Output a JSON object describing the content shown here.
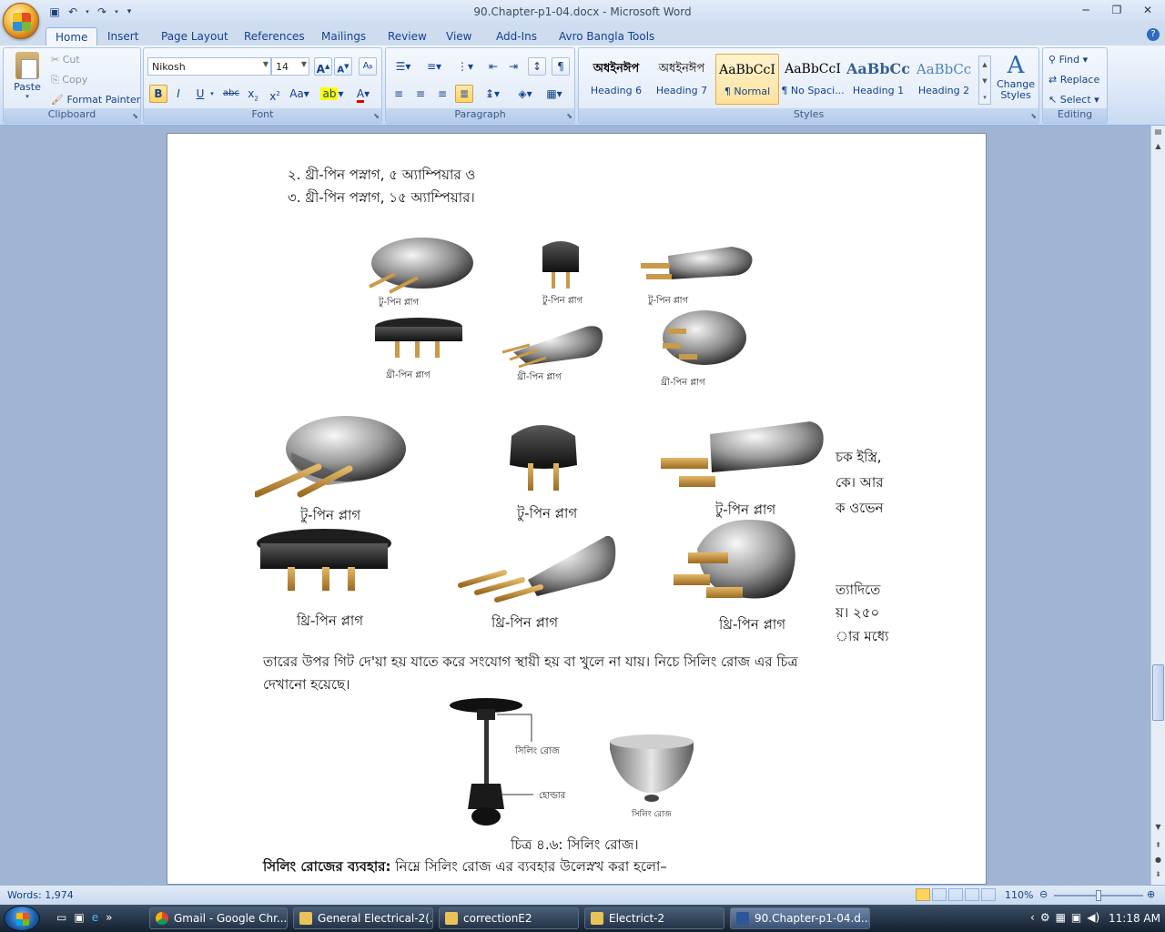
{
  "window": {
    "title": "90.Chapter-p1-04.docx - Microsoft Word"
  },
  "tabs": [
    "Home",
    "Insert",
    "Page Layout",
    "References",
    "Mailings",
    "Review",
    "View",
    "Add-Ins",
    "Avro Bangla Tools"
  ],
  "clipboard": {
    "paste": "Paste",
    "cut": "Cut",
    "copy": "Copy",
    "format_painter": "Format Painter",
    "label": "Clipboard"
  },
  "font": {
    "name": "Nikosh",
    "size": "14",
    "label": "Font"
  },
  "paragraph": {
    "label": "Paragraph"
  },
  "styles": {
    "label": "Styles",
    "items": [
      {
        "preview": "অধইনঈপ",
        "name": "Heading 6"
      },
      {
        "preview": "অধইনঈপ",
        "name": "Heading 7"
      },
      {
        "preview": "AaBbCcI",
        "name": "¶ Normal"
      },
      {
        "preview": "AaBbCcI",
        "name": "¶ No Spaci..."
      },
      {
        "preview": "AaBbCc",
        "name": "Heading 1"
      },
      {
        "preview": "AaBbCc",
        "name": "Heading 2"
      }
    ],
    "change_styles": "Change Styles"
  },
  "editing": {
    "find": "Find",
    "replace": "Replace",
    "select": "Select",
    "label": "Editing"
  },
  "document": {
    "line1": "২. থ্রী-পিন পস্নাগ, ৫ অ্যাম্পিয়ার ও",
    "line2": "৩. থ্রী-পিন পস্নাগ, ১৫ অ্যাম্পিয়ার।",
    "small_captions": [
      "টু-পিন প্লাগ",
      "টু-পিন প্লাগ",
      "টু-পিন প্লাগ",
      "থ্রী-পিন প্লাগ",
      "থ্রী-পিন প্লাগ",
      "থ্রী-পিন প্লাগ"
    ],
    "big_captions": [
      "টু-পিন প্লাগ",
      "টু-পিন প্লাগ",
      "টু-পিন প্লাগ",
      "থ্রি-পিন প্লাগ",
      "থ্রি-পিন প্লাগ",
      "থ্রি-পিন প্লাগ"
    ],
    "right_fragments": [
      "চক ইস্ত্রি,",
      "কে। আর",
      "ক ওভেন",
      "ত্যাদিতে",
      "য়। ২৫০",
      "ার মধ্যে"
    ],
    "para1": "তারের উপর গিট দে'য়া হয় যাতে করে সংযোগ স্থায়ী হয় বা খুলে না যায়। নিচে সিলিং রোজ এর চিত্র",
    "para2": "দেখানো হয়েছে।",
    "rose_label1": "সিলিং রোজ",
    "rose_label2": "হোল্ডার",
    "rose_label3": "সিলিং রোজ",
    "figure_caption": "চিত্র ৪.৬: সিলিং রোজ।",
    "heading_bold": "সিলিং রোজের ব্যবহার:",
    "heading_rest": " নিম্নে সিলিং রোজ এর ব্যবহার উলেস্নখ করা হলো–"
  },
  "status": {
    "words": "Words: 1,974",
    "zoom": "110%"
  },
  "taskbar": {
    "items": [
      "Gmail - Google Chr...",
      "General Electrical-2(...",
      "correctionE2",
      "Electrict-2",
      "90.Chapter-p1-04.d..."
    ],
    "time": "11:18 AM"
  },
  "colors": {
    "ribbon": "#dbe7f7",
    "accent": "#15428b",
    "taskbar": "#1c2a3d"
  }
}
